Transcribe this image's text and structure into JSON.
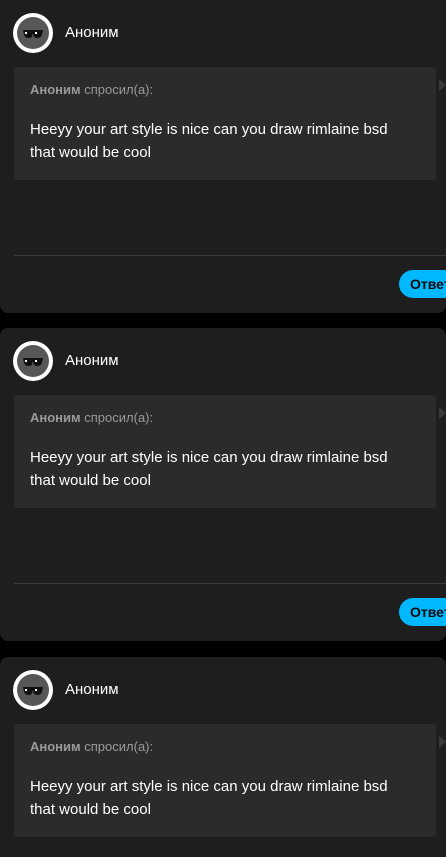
{
  "posts": [
    {
      "author": "Аноним",
      "asked_name": "Аноним",
      "asked_suffix": " спросил(а):",
      "question": "Heeyy your art style is nice can you draw rimlaine bsd that would be cool",
      "answer_label": "Ответить"
    },
    {
      "author": "Аноним",
      "asked_name": "Аноним",
      "asked_suffix": " спросил(а):",
      "question": "Heeyy your art style is nice can you draw rimlaine bsd that would be cool",
      "answer_label": "Ответить"
    },
    {
      "author": "Аноним",
      "asked_name": "Аноним",
      "asked_suffix": " спросил(а):",
      "question": "Heeyy your art style is nice can you draw rimlaine bsd that would be cool"
    }
  ],
  "icons": {
    "avatar": "anonymous-sunglasses-icon",
    "expand": "triangle-right-icon"
  },
  "colors": {
    "card_bg": "#1e1e1e",
    "question_bg": "#2b2b2b",
    "accent": "#00b8ff"
  }
}
